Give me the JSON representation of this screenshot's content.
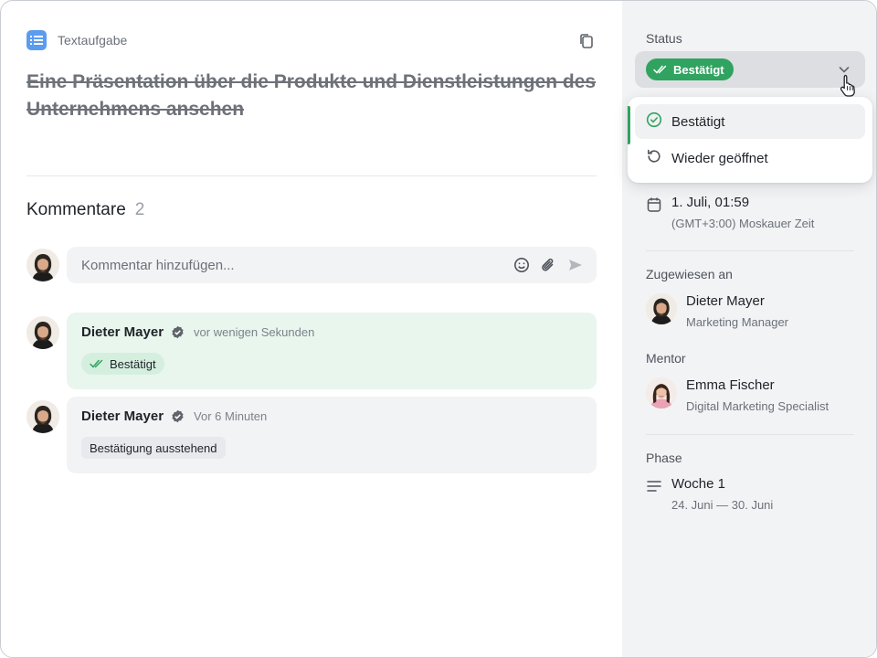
{
  "task": {
    "type_label": "Textaufgabe",
    "title": "Eine Präsentation über die Produkte und Dienstleistungen des Unternehmens ansehen"
  },
  "comments": {
    "title": "Kommentare",
    "count": "2",
    "input_placeholder": "Kommentar hinzufügen...",
    "items": [
      {
        "author": "Dieter Mayer",
        "time": "vor wenigen Sekunden",
        "tag": "Bestätigt",
        "tag_style": "approved"
      },
      {
        "author": "Dieter Mayer",
        "time": "Vor 6 Minuten",
        "tag": "Bestätigung ausstehend",
        "tag_style": "pending"
      }
    ]
  },
  "sidebar": {
    "status_label": "Status",
    "status_value": "Bestätigt",
    "dropdown_options": [
      "Bestätigt",
      "Wieder geöffnet"
    ],
    "deadline": {
      "date": "1. Juli, 01:59",
      "timezone": "(GMT+3:00) Moskauer Zeit"
    },
    "assigned_label": "Zugewiesen an",
    "assignee": {
      "name": "Dieter Mayer",
      "role": "Marketing Manager"
    },
    "mentor_label": "Mentor",
    "mentor": {
      "name": "Emma Fischer",
      "role": "Digital Marketing Specialist"
    },
    "phase_label": "Phase",
    "phase": {
      "name": "Woche 1",
      "dates": "24. Juni — 30. Juni"
    }
  },
  "colors": {
    "accent_green": "#2fa35f",
    "task_icon_blue": "#5b9cf0",
    "approved_bg": "#e8f6ee"
  },
  "icons": [
    "task-list-icon",
    "copy-icon",
    "emoji-icon",
    "attachment-icon",
    "send-icon",
    "verified-icon",
    "double-check-icon",
    "chevron-down-icon",
    "check-circle-icon",
    "reopen-icon",
    "calendar-icon",
    "phase-lines-icon",
    "pointer-cursor-icon"
  ]
}
